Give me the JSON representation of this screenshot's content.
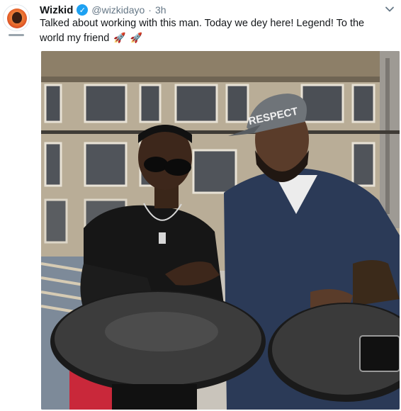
{
  "tweet": {
    "author_name": "Wizkid",
    "handle": "@wizkidayo",
    "separator": "·",
    "time": "3h",
    "verified_mark": "✓",
    "text": "Talked about working with this man. Today we dey here! Legend! To the world my friend",
    "rockets": [
      "🚀",
      "🚀"
    ],
    "menu_icon": "chevron-down-icon",
    "photo": {
      "cap_text": "RESPECT"
    }
  },
  "colors": {
    "verified": "#1da1f2",
    "secondary_text": "#657786",
    "primary_text": "#14171a"
  }
}
